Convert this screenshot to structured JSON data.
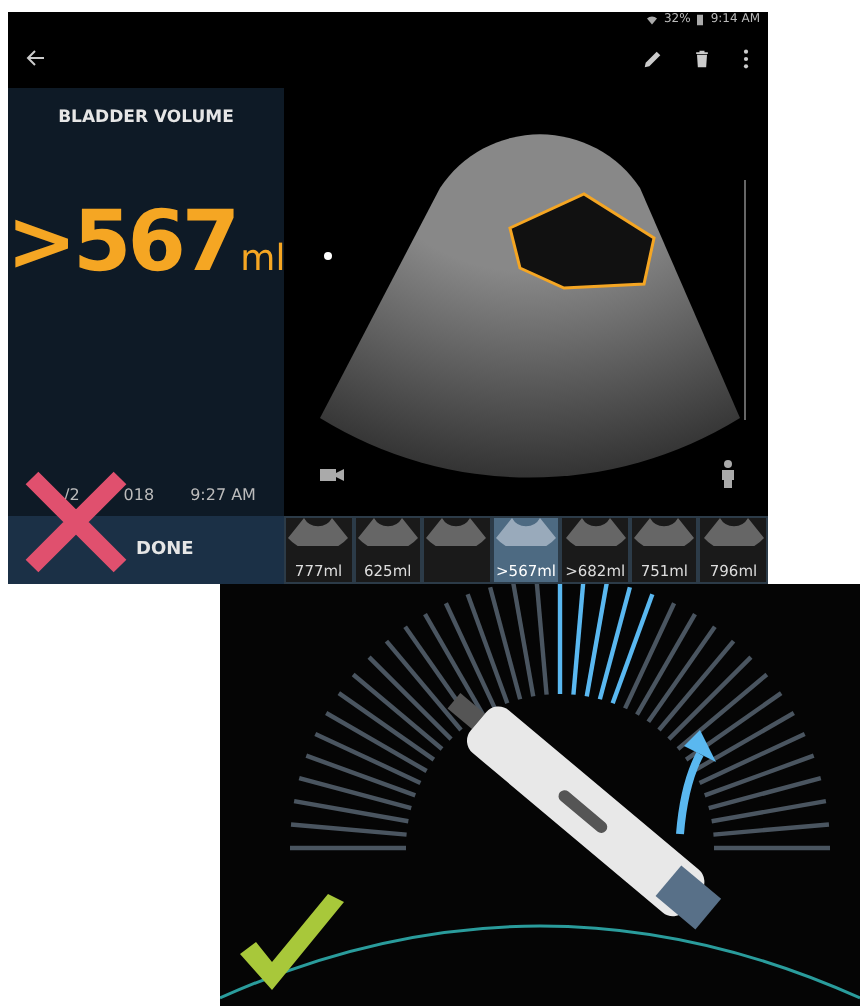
{
  "status_bar": {
    "battery": "32%",
    "time": "9:14 AM"
  },
  "result": {
    "title": "BLADDER VOLUME",
    "value": ">567",
    "unit": "ml",
    "date_parts": [
      "/2",
      "018"
    ],
    "time": "9:27 AM",
    "done_label": "DONE",
    "rejected": true
  },
  "thumbnails": [
    {
      "label": "777ml",
      "selected": false
    },
    {
      "label": "625ml",
      "selected": false
    },
    {
      "selected": false
    },
    {
      "label": ">567ml",
      "selected": true
    },
    {
      "label": ">682ml",
      "selected": false
    },
    {
      "label": "751ml",
      "selected": false
    },
    {
      "label": "796ml",
      "selected": false
    }
  ],
  "guide": {
    "accepted": true
  }
}
